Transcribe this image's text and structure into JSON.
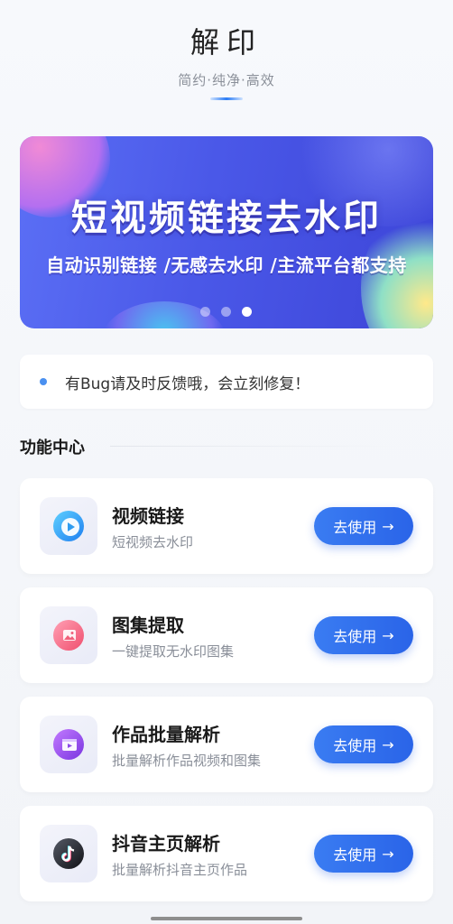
{
  "header": {
    "title": "解印",
    "subtitle": "简约·纯净·高效"
  },
  "banner": {
    "title": "短视频链接去水印",
    "subtitle": "自动识别链接 /无感去水印 /主流平台都支持",
    "dot_count": 3,
    "active_dot": 3
  },
  "notice": {
    "text": "有Bug请及时反馈哦，会立刻修复！"
  },
  "section": {
    "title": "功能中心"
  },
  "features": [
    {
      "title": "视频链接",
      "desc": "短视频去水印",
      "button": "去使用",
      "icon": "video-play-icon",
      "color": "#2f9cf0"
    },
    {
      "title": "图集提取",
      "desc": "一键提取无水印图集",
      "button": "去使用",
      "icon": "image-icon",
      "color": "#f0607a"
    },
    {
      "title": "作品批量解析",
      "desc": "批量解析作品视频和图集",
      "button": "去使用",
      "icon": "video-frame-icon",
      "color": "#8c4ae8"
    },
    {
      "title": "抖音主页解析",
      "desc": "批量解析抖音主页作品",
      "button": "去使用",
      "icon": "tiktok-icon",
      "color": "#1a1a1f"
    }
  ]
}
